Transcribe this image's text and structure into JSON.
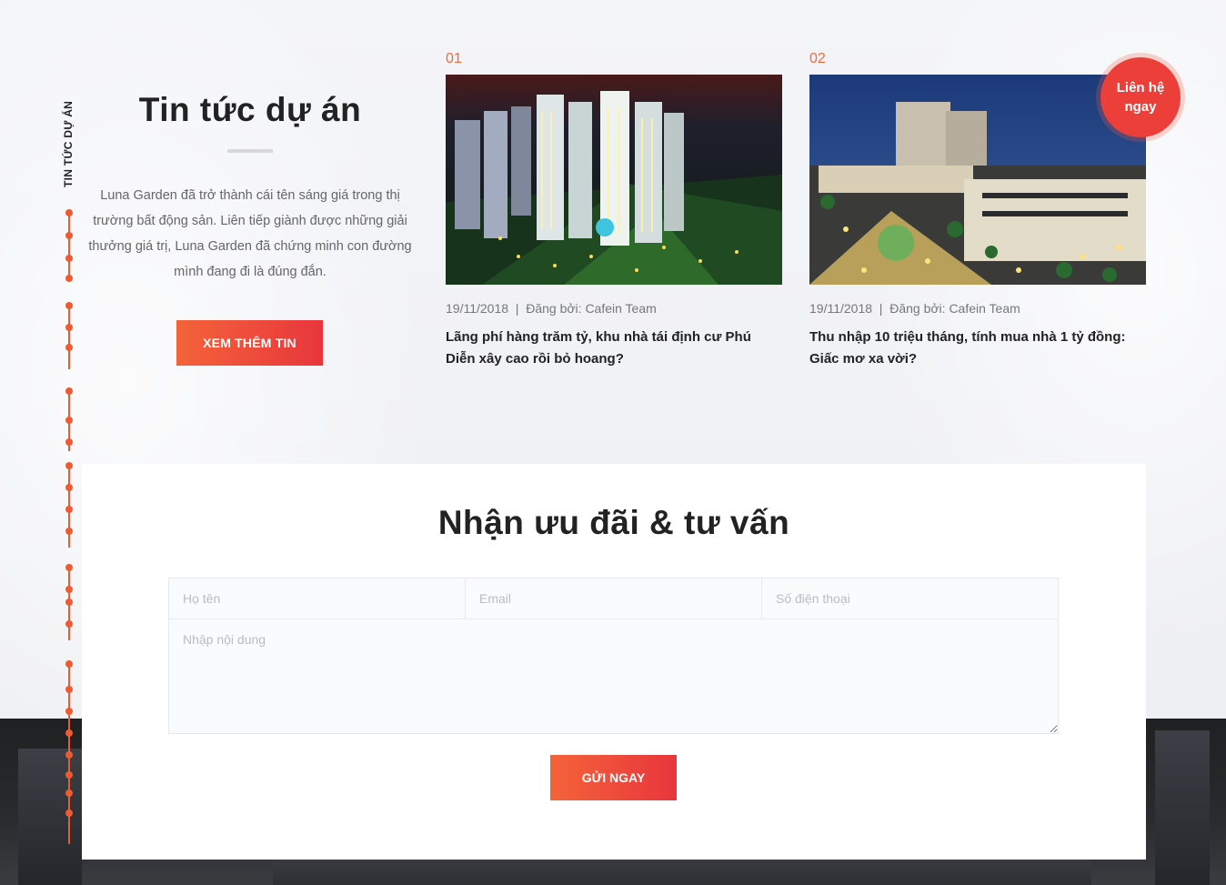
{
  "side_nav": {
    "label": "TIN TỨC DỰ ÁN"
  },
  "intro": {
    "title": "Tin tức dự án",
    "description": "Luna Garden đã trở thành cái tên sáng giá trong thị trường bất động sản. Liên tiếp giành được những giải thưởng giá trị, Luna Garden đã chứng minh con đường mình đang đi là đúng đắn.",
    "button_label": "XEM THÊM TIN"
  },
  "news": [
    {
      "number": "01",
      "meta": "19/11/2018  |  Đăng bởi: Cafein Team",
      "title": "Lãng phí hàng trăm tỷ, khu nhà tái định cư Phú Diễn xây cao rồi bỏ hoang?"
    },
    {
      "number": "02",
      "meta": "19/11/2018  |  Đăng bởi: Cafein Team",
      "title": "Thu nhập 10 triệu tháng, tính mua nhà 1 tỷ đồng: Giấc mơ xa vời?"
    }
  ],
  "contact_badge": {
    "line1": "Liên hệ",
    "line2": "ngay"
  },
  "form": {
    "title": "Nhận ưu đãi & tư vấn",
    "name_placeholder": "Họ tên",
    "email_placeholder": "Email",
    "phone_placeholder": "Số điện thoại",
    "message_placeholder": "Nhập nội dung",
    "submit_label": "GỬI NGAY"
  },
  "colors": {
    "accent": "#f05a32",
    "button_gradient_start": "#f4633a",
    "button_gradient_end": "#e8363c",
    "badge": "#ec3f3a",
    "text_dark": "#222222"
  }
}
